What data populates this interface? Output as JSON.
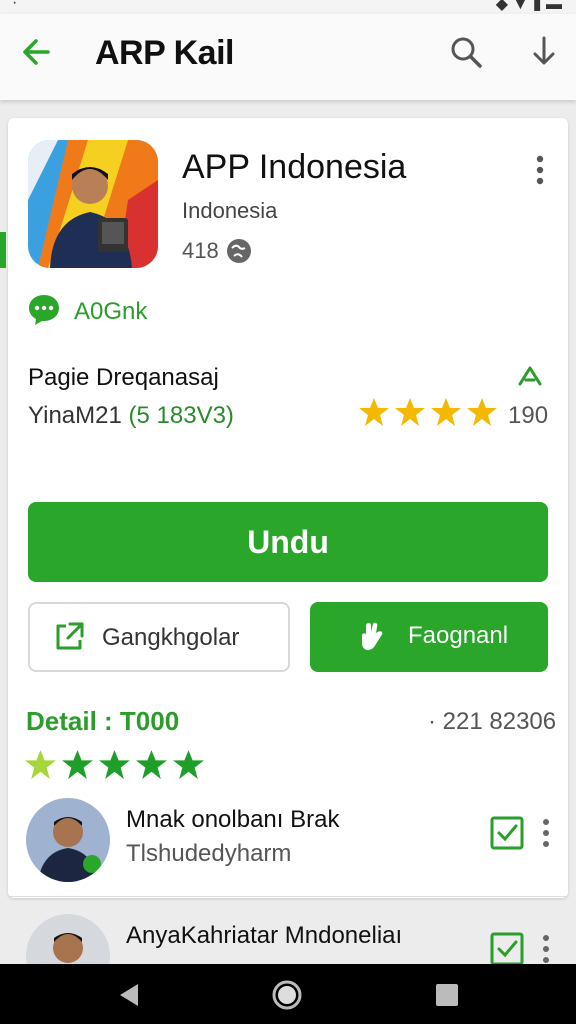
{
  "appbar": {
    "title": "ARP Kail"
  },
  "app": {
    "name": "APP Indonesia",
    "subtitle": "Indonesia",
    "count": "418",
    "chat_label": "A0Gnk",
    "page_name": "Pagie Dreqanasaj",
    "version_prefix": "YinaM21",
    "version_value": "(5 183V3)",
    "rating_count": "190",
    "rating_stars": 4
  },
  "buttons": {
    "main_label": "Undu",
    "outline_label": "Gangkhgolar",
    "fill_label": "Faognanl"
  },
  "detail": {
    "label": "Detail : T000",
    "number": "· 221 82306",
    "stars": 5
  },
  "reviews": [
    {
      "name": "Mnak onolbanı Brak",
      "sub": "Tlshudedyharm"
    },
    {
      "name": "AnyaKahriatar Mndoneliaı",
      "sub": ""
    }
  ],
  "colors": {
    "accent": "#2aa72a",
    "star": "#f5b800",
    "nav": "#000000"
  },
  "icons": [
    "back-arrow-icon",
    "search-icon",
    "download-icon",
    "kebab-icon",
    "globe-icon",
    "chat-icon",
    "arrow-up-icon",
    "share-icon",
    "hand-icon",
    "checkbox-icon",
    "nav-back-icon",
    "nav-home-icon",
    "nav-recents-icon"
  ]
}
